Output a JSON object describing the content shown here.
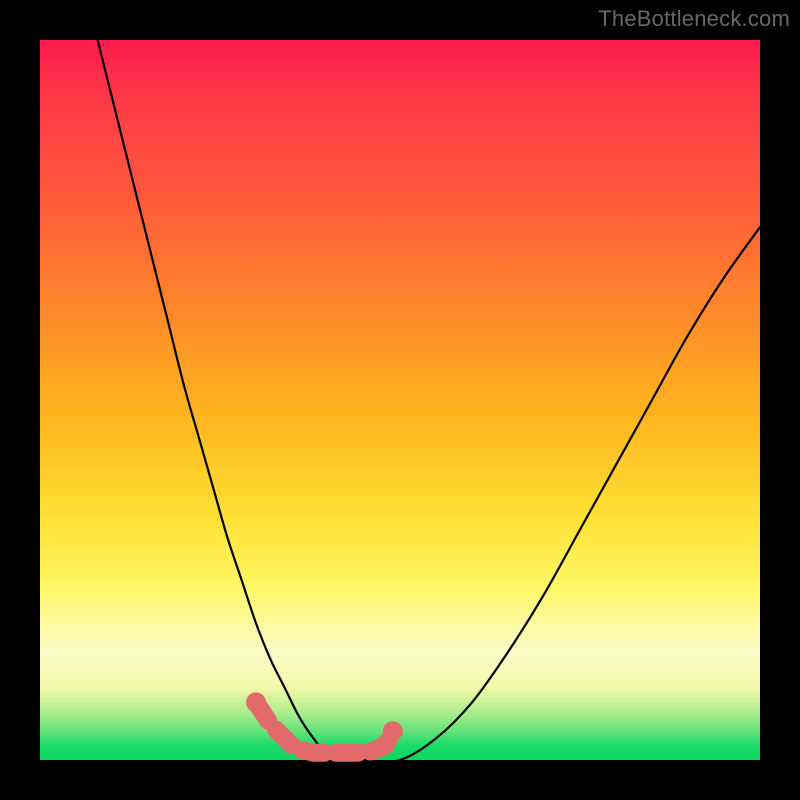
{
  "watermark": "TheBottleneck.com",
  "chart_data": {
    "type": "line",
    "title": "",
    "xlabel": "",
    "ylabel": "",
    "xlim": [
      0,
      100
    ],
    "ylim": [
      0,
      100
    ],
    "grid": false,
    "series": [
      {
        "name": "bottleneck-curve",
        "x": [
          8,
          10,
          12,
          14,
          16,
          18,
          20,
          22,
          24,
          26,
          28,
          30,
          32,
          34,
          36,
          38,
          40,
          45,
          50,
          55,
          60,
          65,
          70,
          75,
          80,
          85,
          90,
          95,
          100
        ],
        "y": [
          100,
          92,
          84,
          76,
          68,
          60,
          52,
          45,
          38,
          31,
          25,
          19,
          14,
          10,
          6,
          3,
          1,
          0,
          0,
          3,
          8,
          15,
          23,
          32,
          41,
          50,
          59,
          67,
          74
        ]
      }
    ],
    "marker": {
      "name": "optimal-range",
      "color": "#e26a6a",
      "points_x": [
        30,
        32,
        34,
        35,
        36,
        38,
        40,
        42,
        44,
        46,
        48,
        49
      ],
      "points_y": [
        8,
        5,
        3,
        2,
        1.5,
        1,
        1,
        1,
        1,
        1.2,
        2,
        4
      ]
    }
  }
}
